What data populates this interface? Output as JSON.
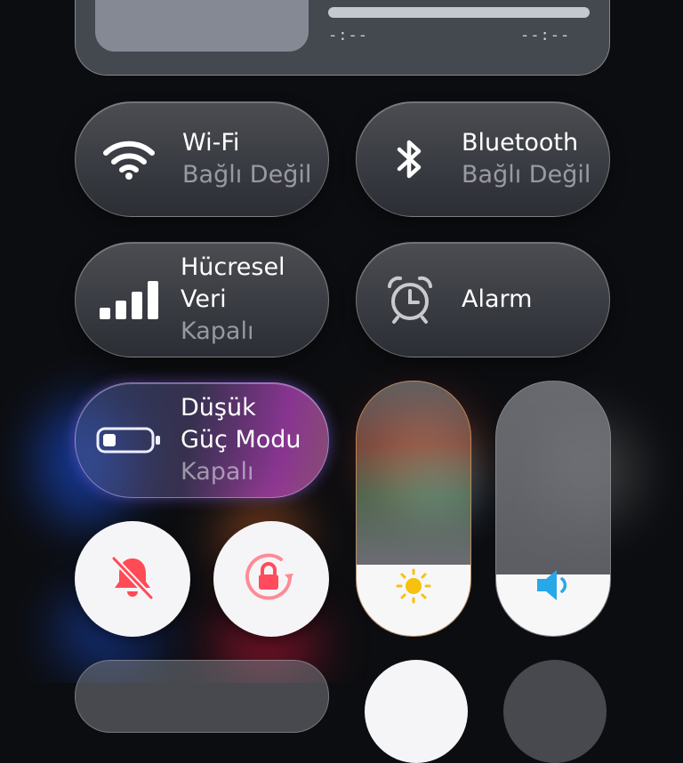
{
  "media": {
    "elapsed": "-:--",
    "remaining": "--:--",
    "progress": 1.0
  },
  "tiles": {
    "wifi": {
      "title": "Wi-Fi",
      "status": "Bağlı Değil"
    },
    "bluetooth": {
      "title": "Bluetooth",
      "status": "Bağlı Değil"
    },
    "cellular": {
      "title_line1": "Hücresel",
      "title_line2": "Veri",
      "status": "Kapalı"
    },
    "alarm": {
      "title": "Alarm"
    },
    "low_power": {
      "title_line1": "Düşük",
      "title_line2": "Güç Modu",
      "status": "Kapalı"
    }
  },
  "sliders": {
    "brightness": {
      "level": 0.28
    },
    "volume": {
      "level": 0.24
    }
  },
  "icons": {
    "wifi": "wifi-icon",
    "bluetooth": "bluetooth-icon",
    "cellular": "cellular-signal-icon",
    "alarm": "alarm-clock-icon",
    "low_power": "battery-low-icon",
    "silent": "bell-slash-icon",
    "rotation_lock": "rotation-lock-icon",
    "brightness": "sun-icon",
    "volume": "speaker-icon"
  },
  "colors": {
    "silent_accent": "#ff4b55",
    "rotation_accent": "#ff5b6b",
    "brightness_accent": "#f7c10d",
    "volume_accent": "#27a8e8",
    "low_power_glow": "#c45cff"
  }
}
